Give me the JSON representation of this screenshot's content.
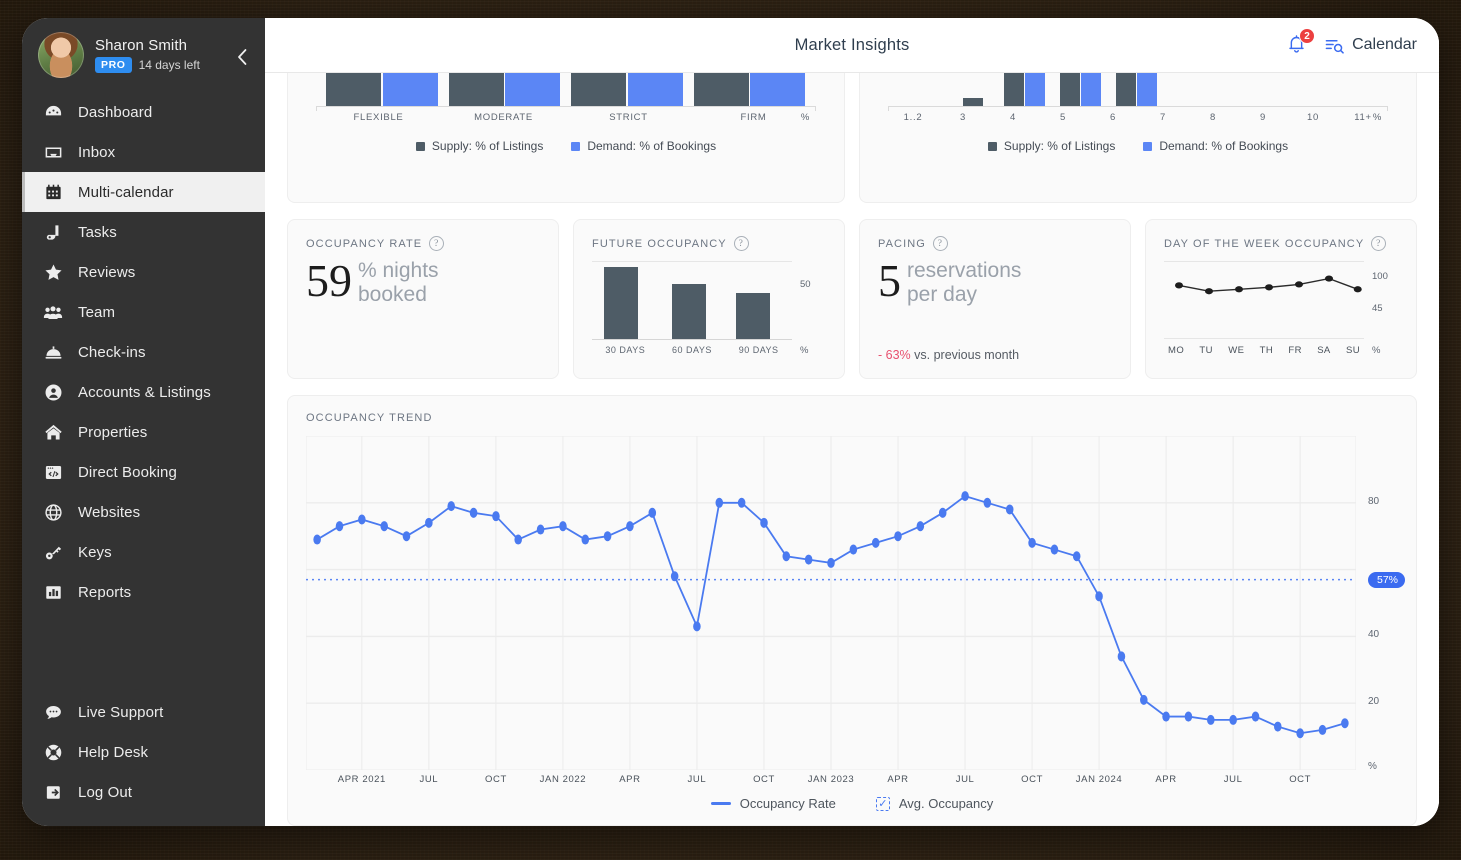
{
  "sidebar": {
    "profile": {
      "name": "Sharon Smith",
      "badge": "PRO",
      "days_left": "14 days left",
      "collapse_label": "‹"
    },
    "items": [
      {
        "label": "Dashboard",
        "icon": "dashboard-icon",
        "active": false
      },
      {
        "label": "Inbox",
        "icon": "inbox-icon",
        "active": false
      },
      {
        "label": "Multi-calendar",
        "icon": "calendar-icon",
        "active": true
      },
      {
        "label": "Tasks",
        "icon": "tasks-icon",
        "active": false
      },
      {
        "label": "Reviews",
        "icon": "star-icon",
        "active": false
      },
      {
        "label": "Team",
        "icon": "team-icon",
        "active": false
      },
      {
        "label": "Check-ins",
        "icon": "bell-desk-icon",
        "active": false
      },
      {
        "label": "Accounts & Listings",
        "icon": "user-circle-icon",
        "active": false
      },
      {
        "label": "Properties",
        "icon": "home-icon",
        "active": false
      },
      {
        "label": "Direct Booking",
        "icon": "browser-code-icon",
        "active": false
      },
      {
        "label": "Websites",
        "icon": "globe-icon",
        "active": false
      },
      {
        "label": "Keys",
        "icon": "key-icon",
        "active": false
      },
      {
        "label": "Reports",
        "icon": "bar-chart-icon",
        "active": false
      }
    ],
    "bottom_items": [
      {
        "label": "Live Support",
        "icon": "chat-icon"
      },
      {
        "label": "Help Desk",
        "icon": "lifebuoy-icon"
      },
      {
        "label": "Log Out",
        "icon": "logout-icon"
      }
    ]
  },
  "header": {
    "title": "Market Insights",
    "notification_count": "2",
    "calendar_label": "Calendar"
  },
  "colors": {
    "supply": "#4e5c66",
    "demand": "#5b86f5",
    "trend_line": "#4a7af0",
    "accent": "#3b6bf0",
    "negative": "#e8516f",
    "sidebar_bg": "#333333"
  },
  "legend_shared": {
    "supply": "Supply: % of Listings",
    "demand": "Demand: % of Bookings"
  },
  "kpis": {
    "occupancy_rate": {
      "title": "Occupancy Rate",
      "value": "59",
      "unit": "% nights booked",
      "help": "?"
    },
    "future_occupancy": {
      "title": "Future Occupancy",
      "help": "?"
    },
    "pacing": {
      "title": "Pacing",
      "value": "5",
      "unit": "reservations per day",
      "delta": "- 63%",
      "delta_suffix": "vs. previous month",
      "help": "?"
    },
    "day_of_week": {
      "title": "Day of the Week Occupancy",
      "help": "?"
    }
  },
  "trend": {
    "title": "Occupancy Trend",
    "avg_badge": "57%",
    "legend_line": "Occupancy Rate",
    "legend_avg": "Avg. Occupancy"
  },
  "chart_data": [
    {
      "id": "cancellation-policy-bars",
      "type": "bar",
      "title": "",
      "note": "Top of bars cropped by scroll — only lower ~33px visible",
      "categories": [
        "FLEXIBLE",
        "MODERATE",
        "STRICT",
        "FIRM"
      ],
      "series": [
        {
          "name": "Supply: % of Listings",
          "values": [
            30,
            30,
            30,
            30
          ],
          "color": "#4e5c66"
        },
        {
          "name": "Demand: % of Bookings",
          "values": [
            30,
            30,
            30,
            30
          ],
          "color": "#5b86f5"
        }
      ],
      "ylabel": "%",
      "grid": false,
      "legend": "bottom"
    },
    {
      "id": "guest-capacity-bars",
      "type": "bar",
      "title": "",
      "note": "Top of bars cropped by scroll",
      "categories": [
        "1..2",
        "3",
        "4",
        "5",
        "6",
        "7",
        "8",
        "9",
        "10",
        "11+"
      ],
      "series": [
        {
          "name": "Supply: % of Listings",
          "values": [
            0,
            7,
            30,
            30,
            30,
            0,
            0,
            0,
            0,
            0
          ],
          "color": "#4e5c66"
        },
        {
          "name": "Demand: % of Bookings",
          "values": [
            0,
            0,
            30,
            30,
            30,
            0,
            0,
            0,
            0,
            0
          ],
          "color": "#5b86f5"
        }
      ],
      "ylabel": "%",
      "grid": false,
      "legend": "bottom"
    },
    {
      "id": "future-occupancy",
      "type": "bar",
      "title": "Future Occupancy",
      "categories": [
        "30 DAYS",
        "60 DAYS",
        "90 DAYS"
      ],
      "values": [
        50,
        38,
        32
      ],
      "ylim": [
        0,
        55
      ],
      "yticks": [
        50
      ],
      "ylabel": "%"
    },
    {
      "id": "day-of-week-occupancy",
      "type": "line",
      "title": "Day of the Week Occupancy",
      "categories": [
        "MO",
        "TU",
        "WE",
        "TH",
        "FR",
        "SA",
        "SU"
      ],
      "values": [
        72,
        68,
        69,
        70,
        72,
        76,
        68
      ],
      "ylim": [
        45,
        100
      ],
      "yticks": [
        100,
        45
      ],
      "ylabel": "%"
    },
    {
      "id": "occupancy-trend",
      "type": "line",
      "title": "Occupancy Trend",
      "xlabel": "",
      "ylabel": "%",
      "ylim": [
        0,
        100
      ],
      "yticks": [
        80,
        40,
        20
      ],
      "grid": true,
      "annotations": [
        {
          "type": "hline",
          "label": "57%",
          "value": 57,
          "color": "#3b6bf0",
          "style": "dotted"
        }
      ],
      "legend": [
        "Occupancy Rate",
        "Avg. Occupancy"
      ],
      "xticks": [
        "APR 2021",
        "JUL",
        "OCT",
        "JAN 2022",
        "APR",
        "JUL",
        "OCT",
        "JAN 2023",
        "APR",
        "JUL",
        "OCT",
        "JAN 2024",
        "APR",
        "JUL",
        "OCT"
      ],
      "x": [
        "FEB 2021",
        "MAR 2021",
        "APR 2021",
        "MAY 2021",
        "JUN 2021",
        "JUL 2021",
        "AUG 2021",
        "SEP 2021",
        "OCT 2021",
        "NOV 2021",
        "DEC 2021",
        "JAN 2022",
        "FEB 2022",
        "MAR 2022",
        "APR 2022",
        "MAY 2022",
        "JUN 2022",
        "JUL 2022",
        "AUG 2022",
        "SEP 2022",
        "OCT 2022",
        "NOV 2022",
        "DEC 2022",
        "JAN 2023",
        "FEB 2023",
        "MAR 2023",
        "APR 2023",
        "MAY 2023",
        "JUN 2023",
        "JUL 2023",
        "AUG 2023",
        "SEP 2023",
        "OCT 2023",
        "NOV 2023",
        "DEC 2023",
        "JAN 2024",
        "FEB 2024",
        "MAR 2024",
        "APR 2024",
        "MAY 2024",
        "JUN 2024",
        "JUL 2024",
        "AUG 2024",
        "SEP 2024",
        "OCT 2024",
        "NOV 2024",
        "DEC 2024"
      ],
      "values": [
        69,
        73,
        75,
        73,
        70,
        74,
        79,
        77,
        76,
        69,
        72,
        73,
        69,
        70,
        73,
        77,
        58,
        43,
        80,
        80,
        74,
        64,
        63,
        62,
        66,
        68,
        70,
        73,
        77,
        82,
        80,
        78,
        68,
        66,
        64,
        52,
        34,
        21,
        16,
        16,
        15,
        15,
        16,
        13,
        11,
        12,
        14
      ]
    }
  ]
}
